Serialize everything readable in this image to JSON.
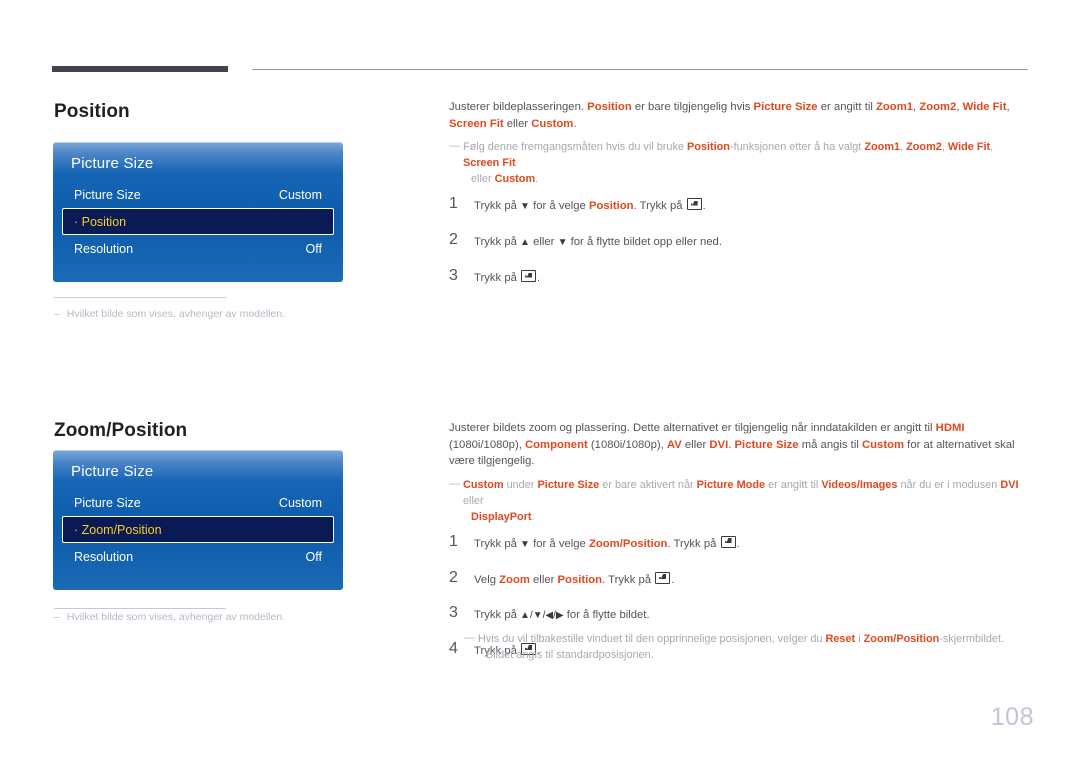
{
  "page": {
    "number": "108"
  },
  "sections": [
    {
      "id": "position",
      "title": "Position",
      "osd": {
        "title": "Picture Size",
        "rows": [
          {
            "label": "Picture Size",
            "value": "Custom",
            "selected": false
          },
          {
            "label": "· Position",
            "value": "",
            "selected": true
          },
          {
            "label": "Resolution",
            "value": "Off",
            "selected": false
          }
        ]
      },
      "footnote": {
        "dash": "–",
        "text": "Hvilket bilde som vises, avhenger av modellen."
      }
    },
    {
      "id": "zoom-position",
      "title": "Zoom/Position",
      "osd": {
        "title": "Picture Size",
        "rows": [
          {
            "label": "Picture Size",
            "value": "Custom",
            "selected": false
          },
          {
            "label": "· Zoom/Position",
            "value": "",
            "selected": true
          },
          {
            "label": "Resolution",
            "value": "Off",
            "selected": false
          }
        ]
      },
      "footnote": {
        "dash": "–",
        "text": "Hvilket bilde som vises, avhenger av modellen."
      }
    }
  ],
  "position_content": {
    "intro_1": "Justerer bildeplasseringen. ",
    "intro_term_1": "Position",
    "intro_2": " er bare tilgjengelig hvis ",
    "intro_term_2": "Picture Size",
    "intro_3": " er angitt til ",
    "intro_term_3": "Zoom1",
    "intro_sep_1": ", ",
    "intro_term_4": "Zoom2",
    "intro_sep_2": ", ",
    "intro_term_5": "Wide Fit",
    "intro_sep_3": ", ",
    "intro_term_6": "Screen Fit",
    "intro_4": " eller ",
    "intro_term_7": "Custom",
    "intro_5": ".",
    "subnote_1": "Følg denne fremgangsmåten hvis du vil bruke ",
    "subnote_term_1": "Position",
    "subnote_2": "-funksjonen etter å ha valgt ",
    "subnote_term_2": "Zoom1",
    "subnote_sep_1": ", ",
    "subnote_term_3": "Zoom2",
    "subnote_sep_2": ", ",
    "subnote_term_4": "Wide Fit",
    "subnote_sep_3": ", ",
    "subnote_term_5": "Screen Fit",
    "subnote_3": "eller ",
    "subnote_term_6": "Custom",
    "subnote_4": ".",
    "steps": [
      {
        "num": "1",
        "pre": "Trykk på ",
        "arrow": "▼",
        "mid": " for å velge ",
        "term": "Position",
        "post": ". Trykk på ",
        "end": ".",
        "has_enter": true
      },
      {
        "num": "2",
        "pre": "Trykk på ",
        "arrow": "▲",
        "mid": " eller ",
        "arrow2": "▼",
        "post": " for å flytte bildet opp eller ned.",
        "has_enter": false
      },
      {
        "num": "3",
        "pre": "Trykk på ",
        "end": ".",
        "has_enter": true
      }
    ]
  },
  "zoom_content": {
    "intro_1": "Justerer bildets zoom og plassering. Dette alternativet er tilgjengelig når inndatakilden er angitt til ",
    "intro_term_1": "HDMI",
    "intro_2": " (1080i/1080p), ",
    "intro_term_2": "Component",
    "intro_3": " (1080i/1080p), ",
    "intro_term_3": "AV",
    "intro_4": " eller ",
    "intro_term_4": "DVI",
    "intro_5": ". ",
    "intro_term_5": "Picture Size",
    "intro_6": " må angis til ",
    "intro_term_6": "Custom",
    "intro_7": " for at alternativet skal være tilgjengelig.",
    "subnote_term_1": "Custom",
    "subnote_1": " under ",
    "subnote_term_2": "Picture Size",
    "subnote_2": " er bare aktivert når ",
    "subnote_term_3": "Picture Mode",
    "subnote_3": " er angitt til ",
    "subnote_term_4": "Videos/Images",
    "subnote_4": " når du er i modusen ",
    "subnote_term_5": "DVI",
    "subnote_5": " eller ",
    "subnote_term_6": "DisplayPort",
    "subnote_6": ".",
    "steps": [
      {
        "num": "1",
        "pre": "Trykk på ",
        "arrow": "▼",
        "mid": " for å velge ",
        "term": "Zoom/Position",
        "post": ". Trykk på ",
        "end": ".",
        "has_enter": true
      },
      {
        "num": "2",
        "pre": "Velg ",
        "term": "Zoom",
        "mid": " eller ",
        "term2": "Position",
        "post": ". Trykk på ",
        "end": ".",
        "has_enter": true
      },
      {
        "num": "3",
        "pre": "Trykk på ",
        "arrows": "▲/▼/◀/▶",
        "post": " for å flytte bildet.",
        "has_enter": false
      },
      {
        "num": "4",
        "pre": "Trykk på ",
        "end": ".",
        "has_enter": true
      }
    ],
    "bottom_note": {
      "dash": "—",
      "t1": "Hvis du vil tilbakestille vinduet til den opprinnelige posisjonen, velger du ",
      "term1": "Reset",
      "t2": " i ",
      "term2": "Zoom/Position",
      "t3": "-skjermbildet.",
      "t4": "Bildet angis til standardposisjonen."
    }
  }
}
